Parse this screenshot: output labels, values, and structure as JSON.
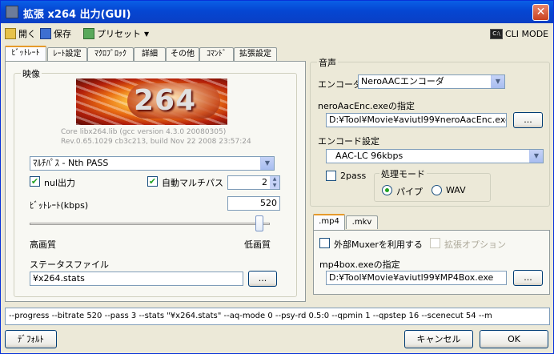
{
  "window": {
    "title": "拡張 x264 出力(GUI)",
    "close_glyph": "✕"
  },
  "toolbar": {
    "open_label": "開く",
    "save_label": "保存",
    "preset_label": "プリセット",
    "preset_arrow": "▼",
    "cli_mode_label": "CLI MODE",
    "cli_icon_text": "C:\\"
  },
  "tabs": [
    {
      "label": "ﾋﾞｯﾄﾚｰﾄ",
      "active": true
    },
    {
      "label": "ﾚｰﾄ設定"
    },
    {
      "label": "ﾏｸﾛﾌﾞﾛｯｸ"
    },
    {
      "label": "詳細"
    },
    {
      "label": "その他"
    },
    {
      "label": "ｺﾏﾝﾄﾞ"
    },
    {
      "label": "拡張設定"
    }
  ],
  "video": {
    "group_label": "映像",
    "logo_text": "264",
    "version_line1": "Core libx264.lib (gcc version 4.3.0 20080305)",
    "version_line2": "Rev.0.65.1029 cb3c213, build Nov 22 2008 23:57:24",
    "mode_value": "ﾏﾙﾁﾊﾟｽ - Nth PASS",
    "nul_output_label": "nul出力",
    "nul_output_checked": true,
    "auto_multipass_label": "自動マルチパス",
    "auto_multipass_checked": true,
    "auto_multipass_value": "2",
    "bitrate_label": "ﾋﾞｯﾄﾚｰﾄ(kbps)",
    "bitrate_value": "520",
    "quality_level": 0.94,
    "high_quality_label": "高画質",
    "low_quality_label": "低画質",
    "stats_label": "ステータスファイル",
    "stats_value": "¥x264.stats",
    "browse_label": "..."
  },
  "audio": {
    "group_label": "音声",
    "encoder_label": "エンコーダ",
    "encoder_value": "NeroAACエンコーダ",
    "path_label": "neroAacEnc.exeの指定",
    "path_value": "D:¥Tool¥Movie¥aviutl99¥neroAacEnc.exe",
    "browse_label": "...",
    "encode_setting_label": "エンコード設定",
    "encode_setting_value": "AAC-LC 96kbps",
    "twopass_label": "2pass",
    "twopass_checked": false,
    "process_mode_label": "処理モード",
    "pipe_label": "パイプ",
    "pipe_checked": true,
    "wav_label": "WAV",
    "wav_checked": false
  },
  "container": {
    "tabs": [
      {
        "label": ".mp4",
        "active": true
      },
      {
        "label": ".mkv"
      }
    ],
    "external_muxer_label": "外部Muxerを利用する",
    "external_muxer_checked": false,
    "extension_option_label": "拡張オプション",
    "mp4box_label": "mp4box.exeの指定",
    "mp4box_value": "D:¥Tool¥Movie¥aviutl99¥MP4Box.exe",
    "browse_label": "..."
  },
  "command_line": "--progress --bitrate 520 --pass 3 --stats \"¥x264.stats\" --aq-mode 0 --psy-rd 0.5:0 --qpmin 1 --qpstep 16 --scenecut 54 --m",
  "footer": {
    "default_label": "ﾃﾞﾌｫﾙﾄ",
    "cancel_label": "キャンセル",
    "ok_label": "OK"
  }
}
